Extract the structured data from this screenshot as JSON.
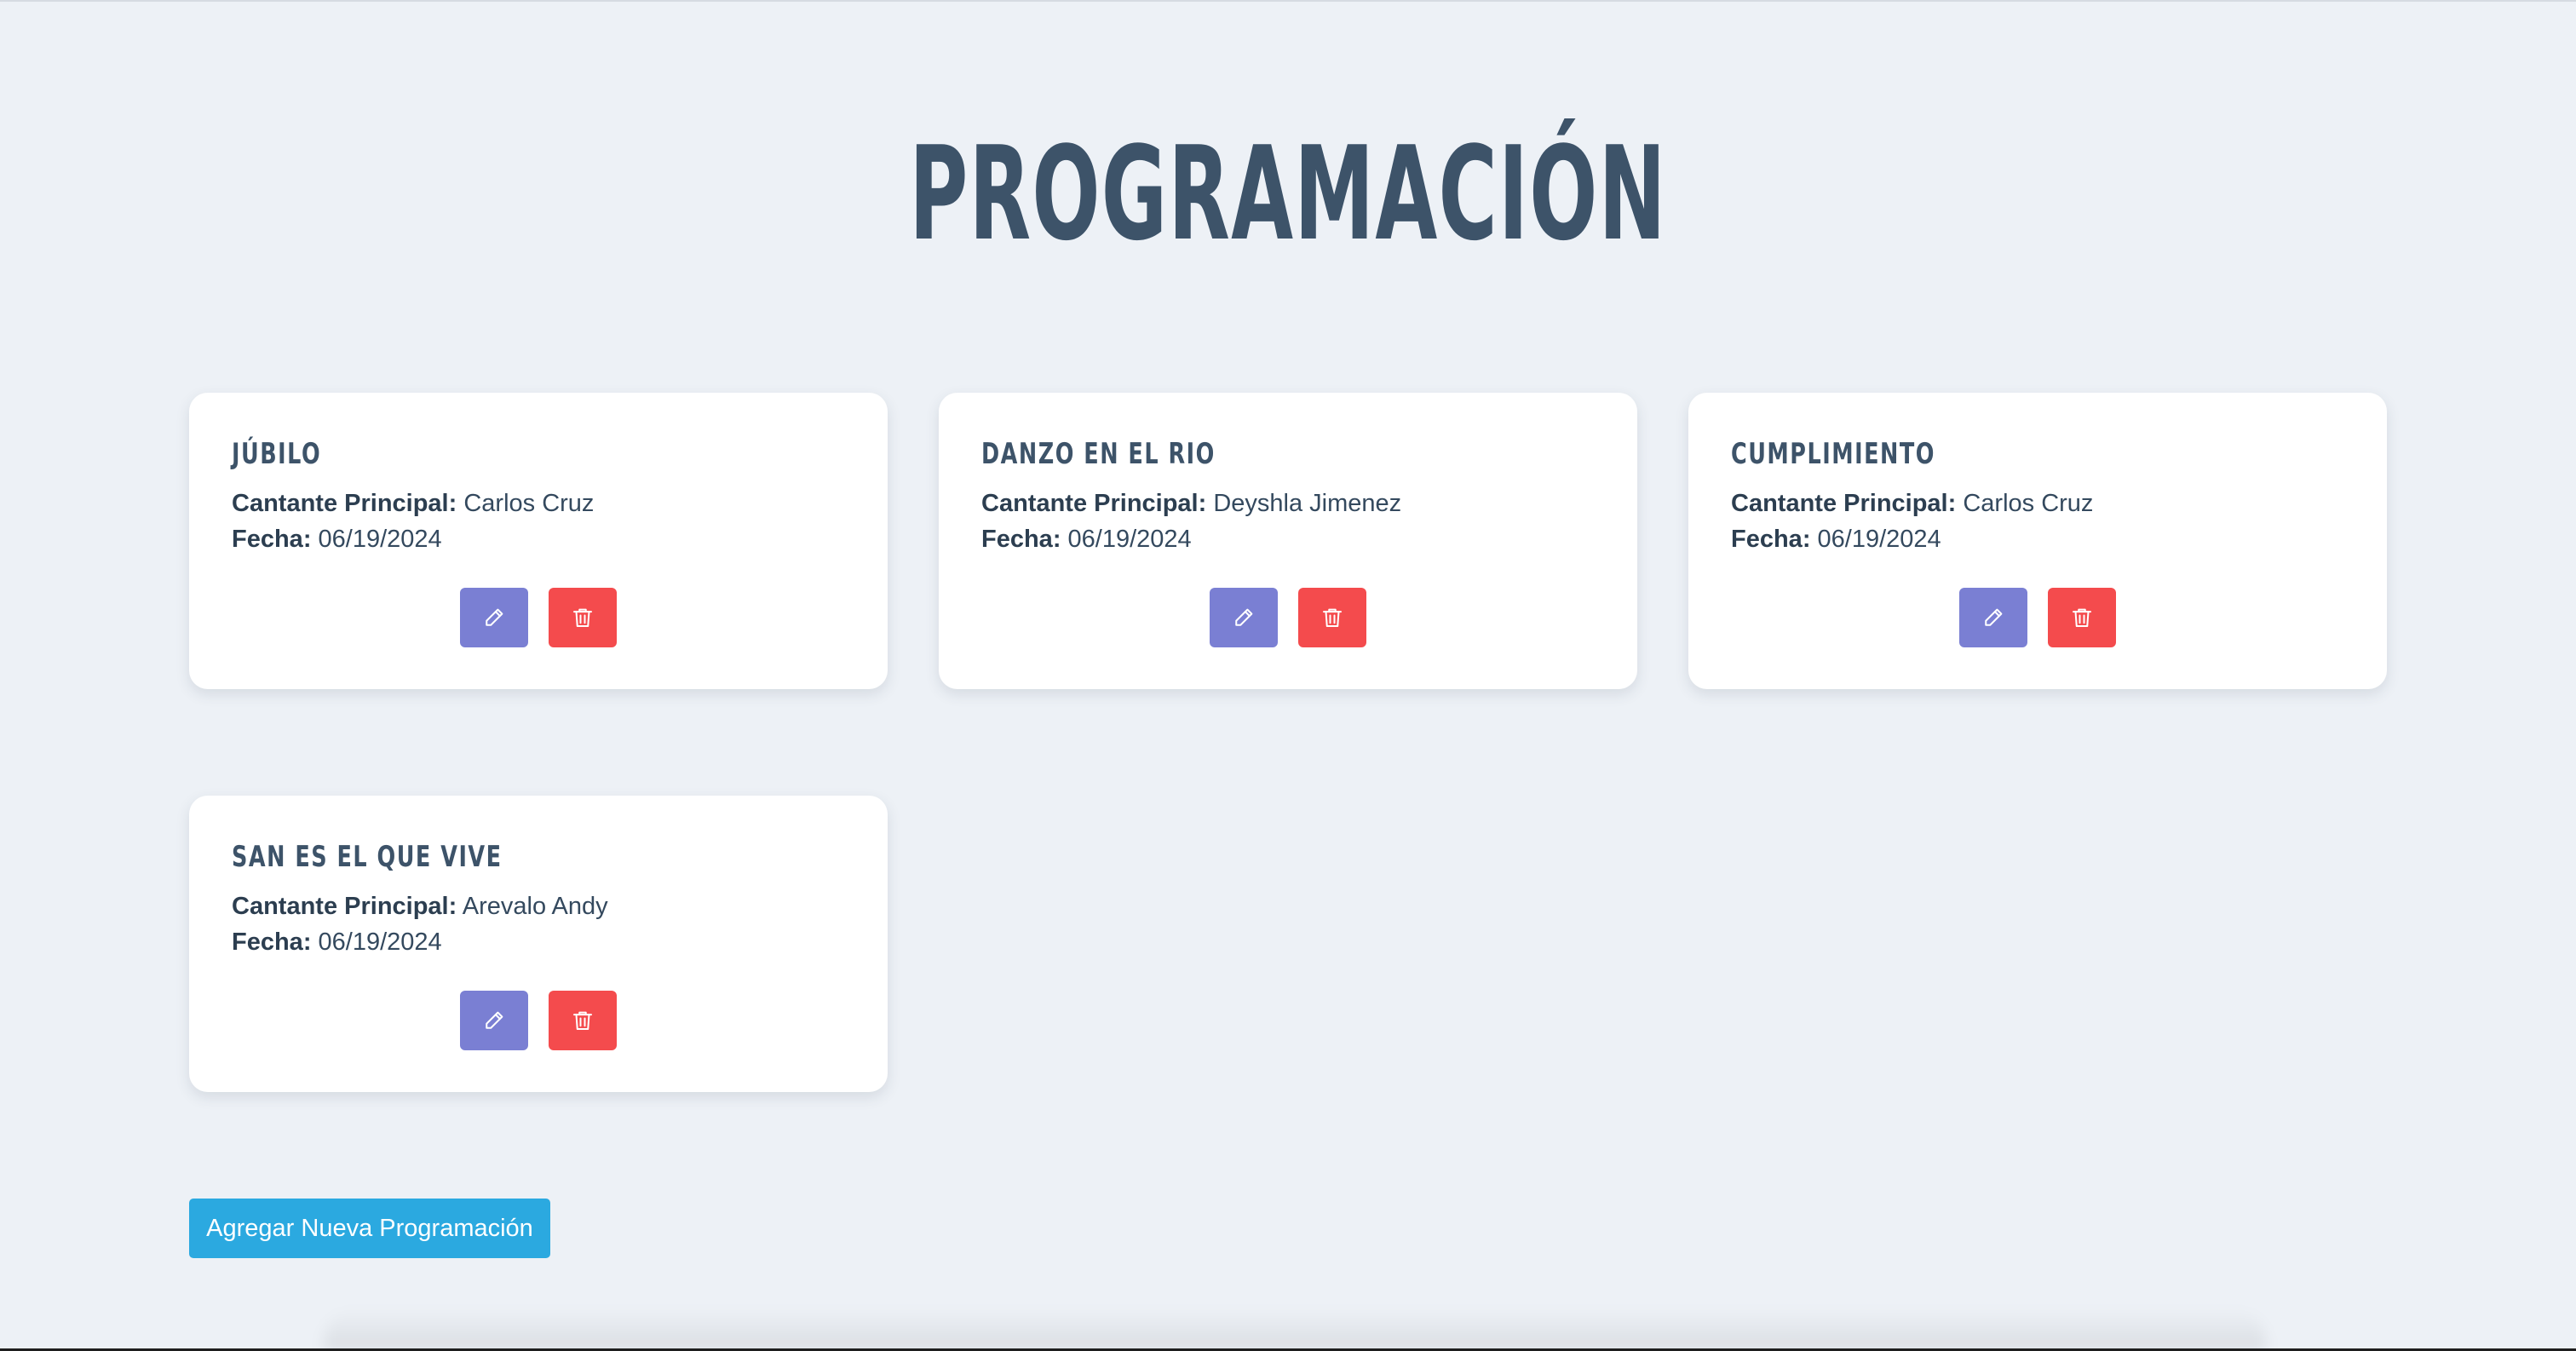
{
  "page": {
    "title": "PROGRAMACIÓN",
    "background": "#edf1f6",
    "title_color": "#3d5369"
  },
  "labels": {
    "singer": "Cantante Principal:",
    "date": "Fecha:"
  },
  "programs": [
    {
      "title": "JÚBILO",
      "singer": "Carlos Cruz",
      "date": "06/19/2024"
    },
    {
      "title": "DANZO EN EL RIO",
      "singer": "Deyshla Jimenez",
      "date": "06/19/2024"
    },
    {
      "title": "CUMPLIMIENTO",
      "singer": "Carlos Cruz",
      "date": "06/19/2024"
    },
    {
      "title": "SAN ES EL QUE VIVE",
      "singer": "Arevalo Andy",
      "date": "06/19/2024"
    }
  ],
  "actions": {
    "edit_icon": "pencil-icon",
    "delete_icon": "trash-icon",
    "edit_color": "#7a7fd3",
    "delete_color": "#f44b4d"
  },
  "add_button": {
    "label": "Agregar Nueva Programación",
    "color": "#2ba9e0"
  }
}
